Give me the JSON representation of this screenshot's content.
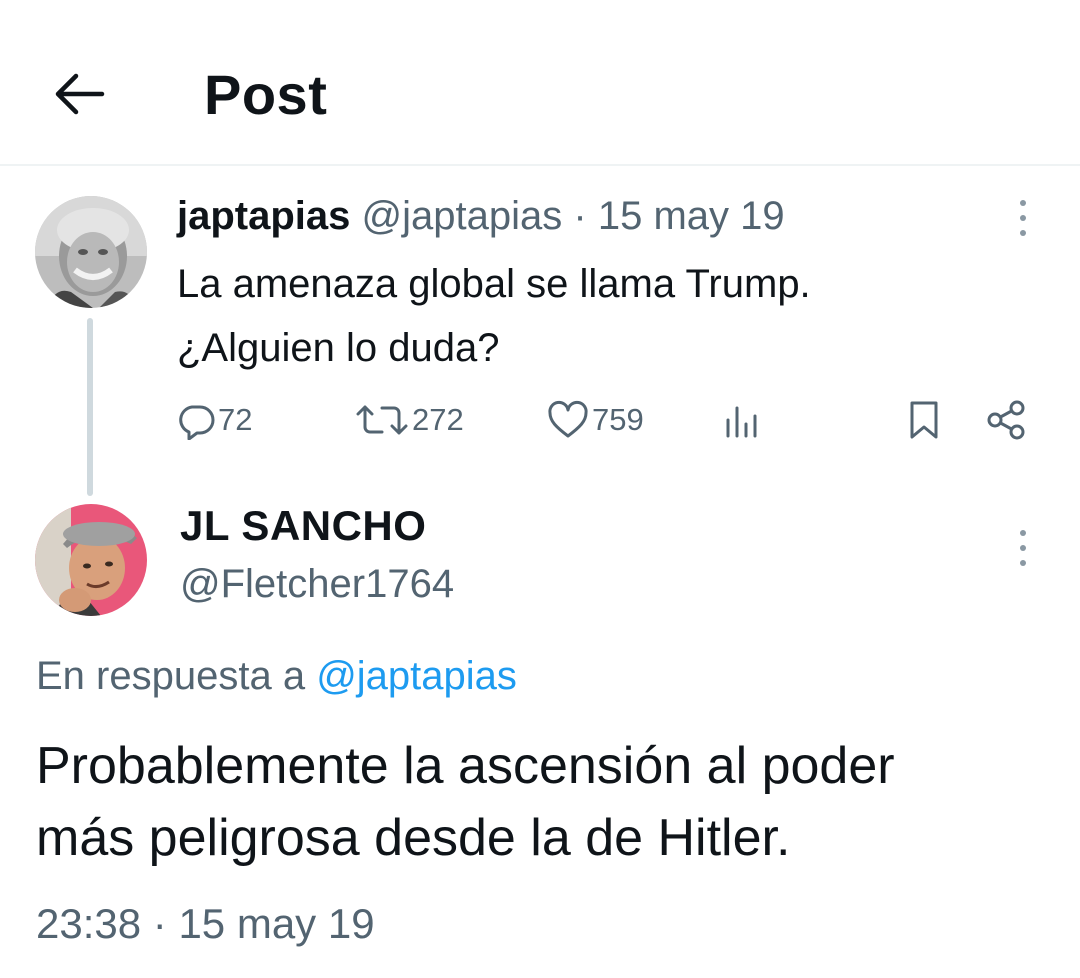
{
  "header": {
    "title": "Post",
    "back_icon": "arrow-left-icon"
  },
  "original_post": {
    "display_name": "japtapias",
    "handle": "@japtapias",
    "separator": "·",
    "date": "15 may 19",
    "text_line_1": "La amenaza global se llama Trump.",
    "text_line_2": "¿Alguien lo duda?",
    "stats": {
      "replies": "72",
      "reposts": "272",
      "likes": "759"
    }
  },
  "reply_post": {
    "display_name": "JL SANCHO",
    "handle": "@Fletcher1764",
    "reply_prefix": "En respuesta a",
    "reply_mention": "@japtapias",
    "text_line_1": "Probablemente la ascensión al poder",
    "text_line_2": "más peligrosa desde la de Hitler.",
    "time": "23:38",
    "separator": "·",
    "date": "15 may 19"
  },
  "colors": {
    "text_primary": "#0f1419",
    "text_secondary": "#536471",
    "accent": "#1d9bf0",
    "divider": "#eff3f4",
    "thread_line": "#cfd9de"
  }
}
